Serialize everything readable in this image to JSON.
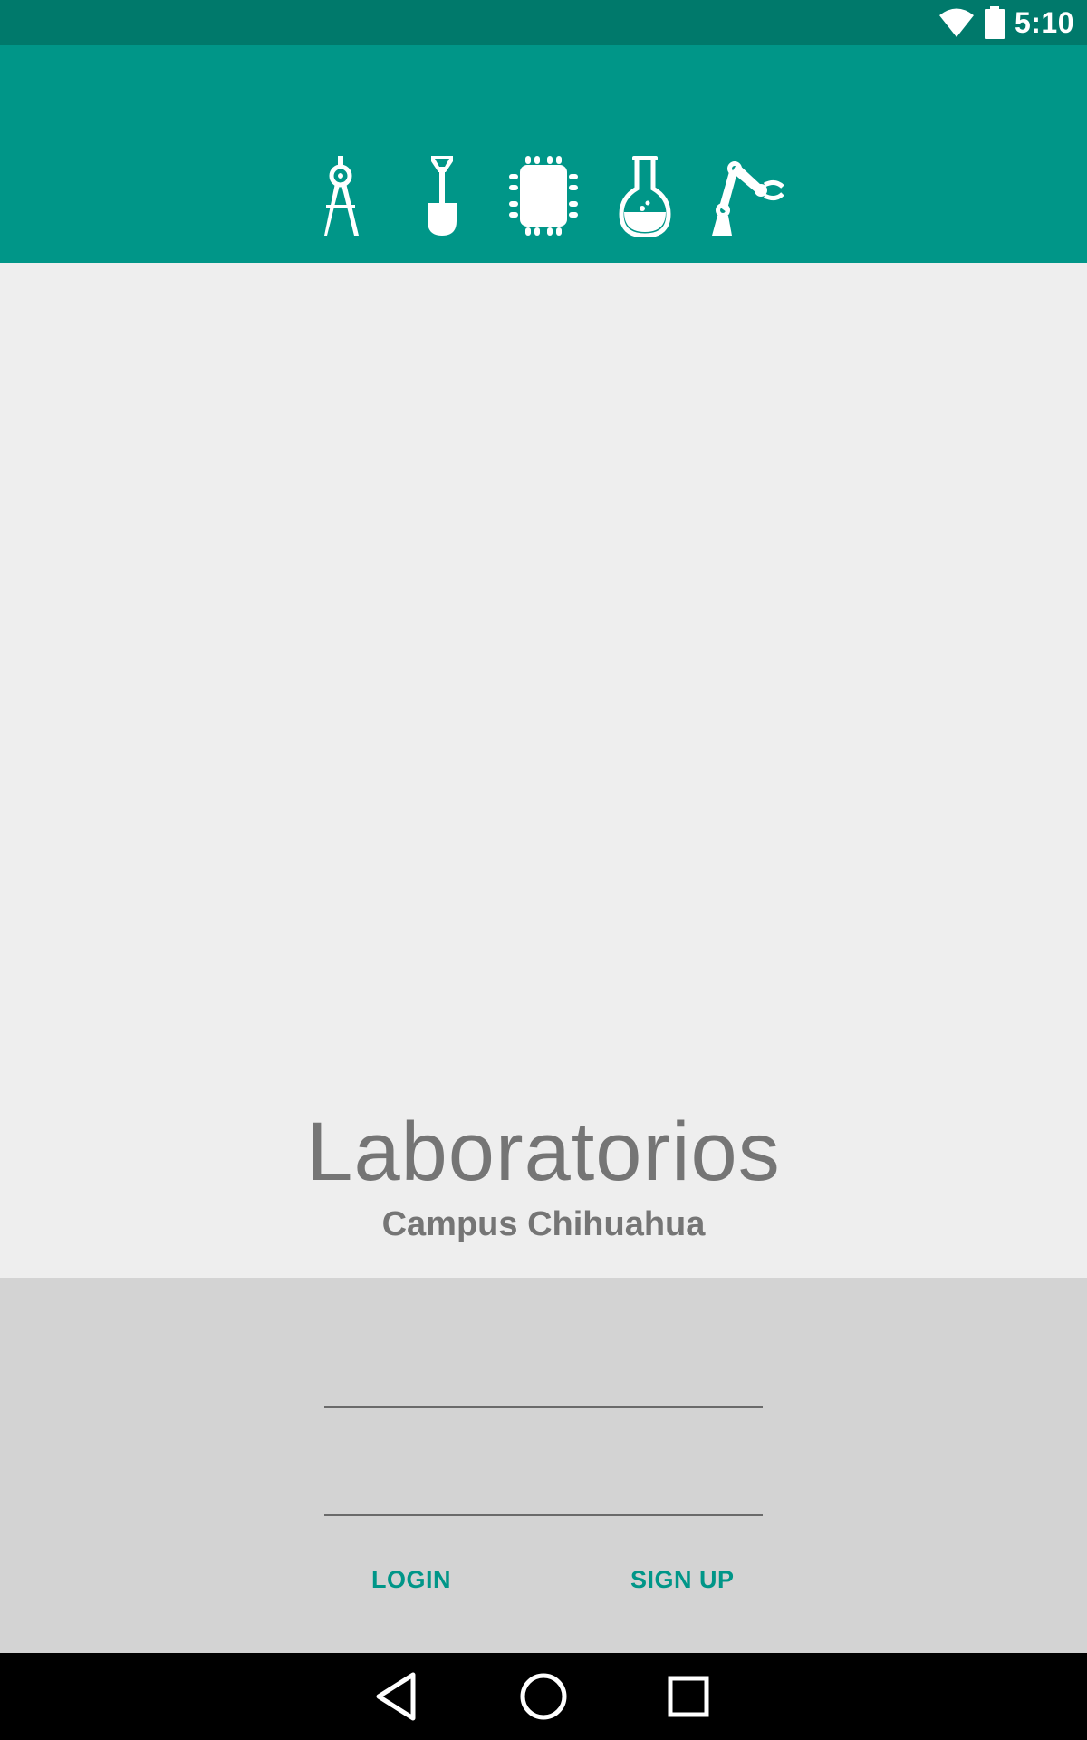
{
  "status_bar": {
    "time": "5:10",
    "icons": [
      "wifi-icon",
      "battery-icon"
    ]
  },
  "header": {
    "icons": [
      "compass-drafting-icon",
      "shovel-icon",
      "microchip-icon",
      "flask-icon",
      "robotic-arm-icon"
    ]
  },
  "main": {
    "title": "Laboratorios",
    "subtitle": "Campus Chihuahua"
  },
  "form": {
    "username": {
      "value": "",
      "placeholder": ""
    },
    "password": {
      "value": "",
      "placeholder": ""
    },
    "login_label": "LOGIN",
    "signup_label": "SIGN UP"
  },
  "nav_bar": {
    "buttons": [
      "back-icon",
      "home-icon",
      "recents-icon"
    ]
  },
  "colors": {
    "primary": "#009688",
    "primary_dark": "#00796b",
    "background": "#eeeeee",
    "form_background": "#d3d3d3",
    "text_gray": "#757575"
  }
}
